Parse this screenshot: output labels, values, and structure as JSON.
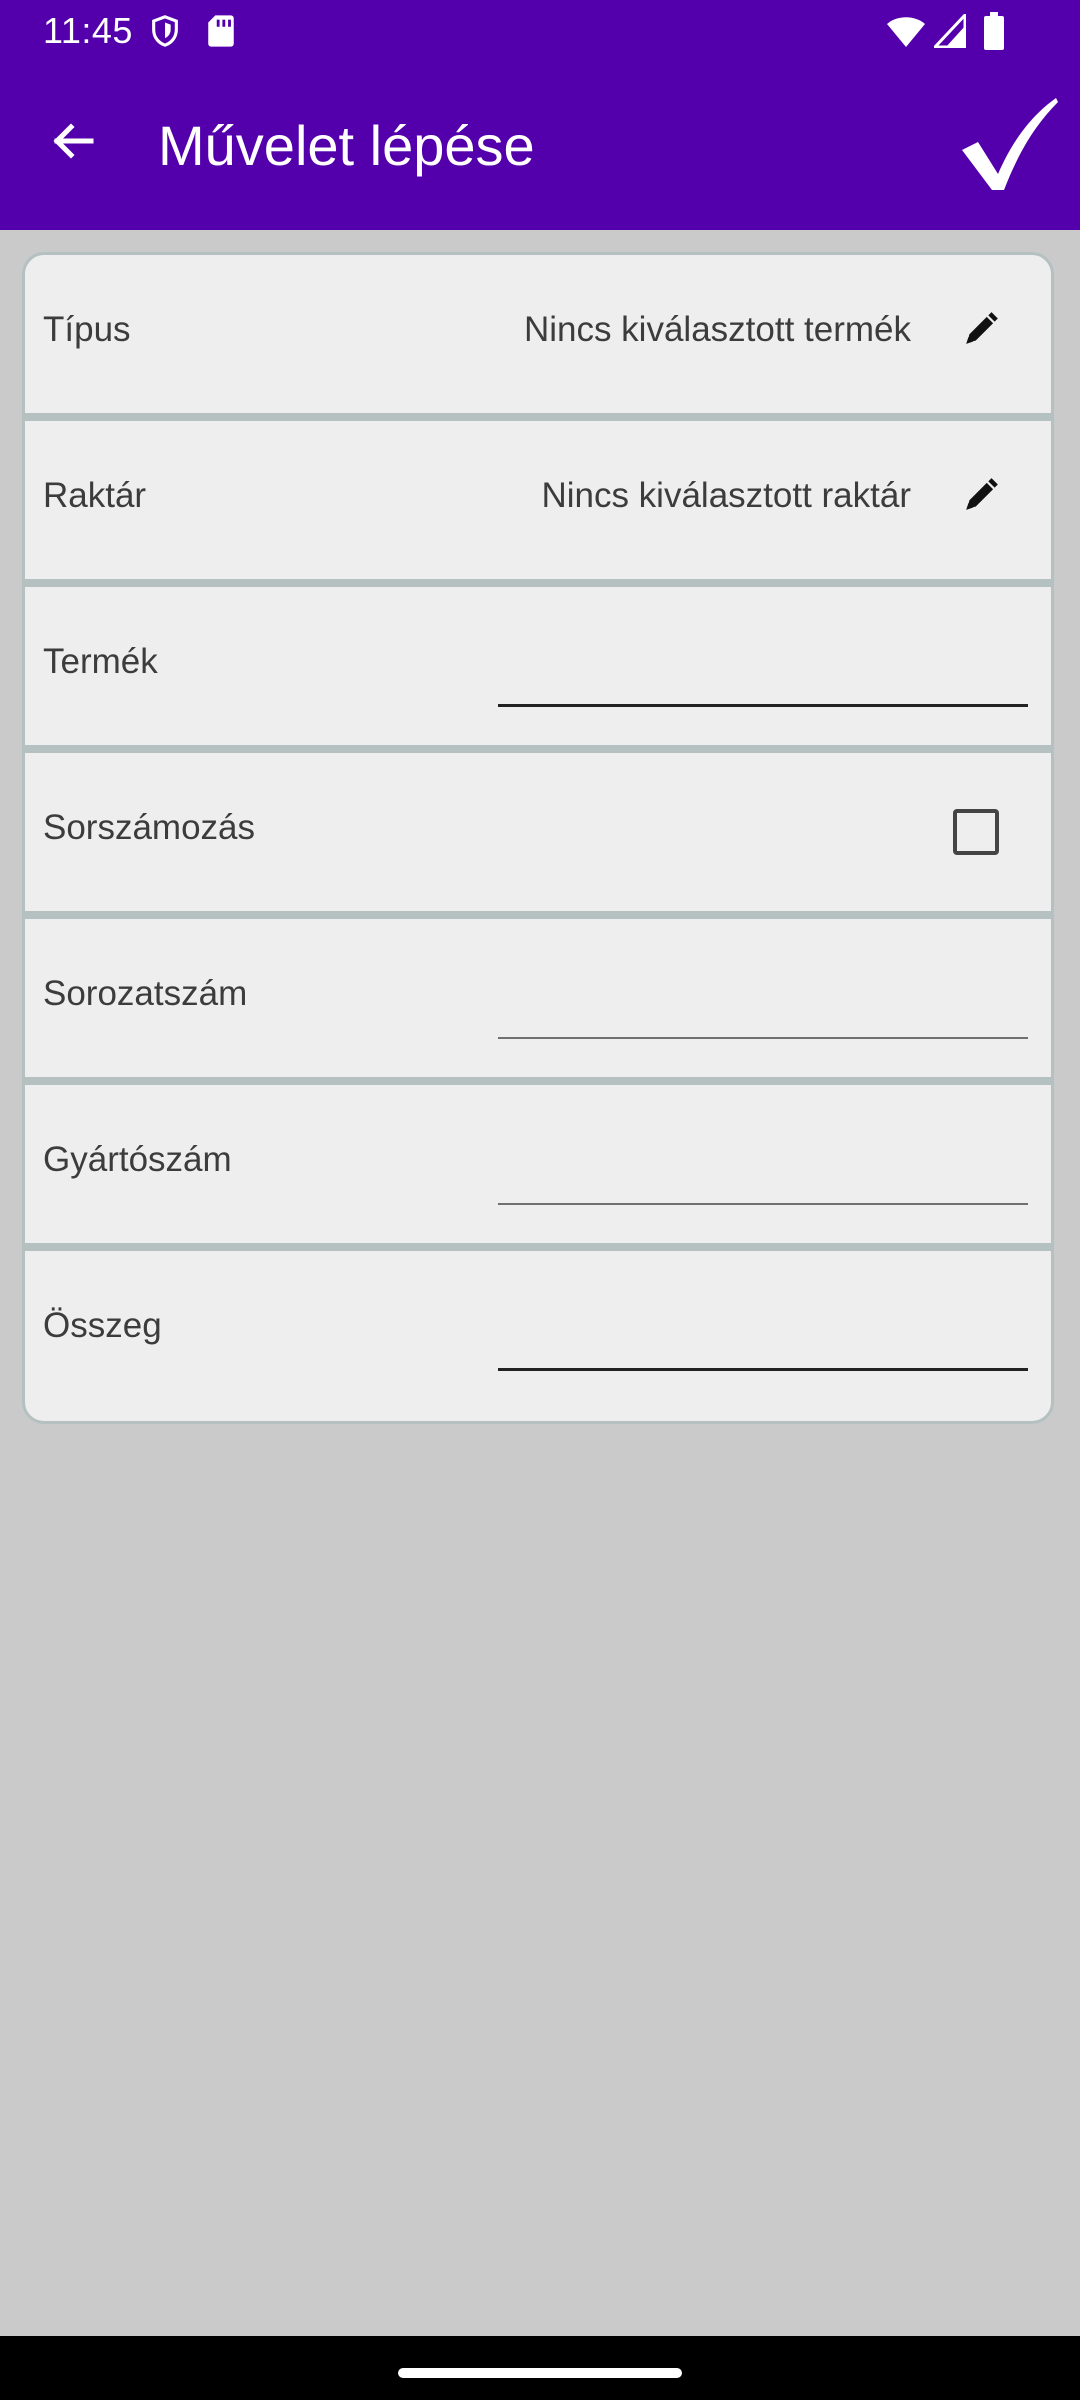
{
  "status_bar": {
    "time": "11:45",
    "icons": [
      "shield-icon",
      "sd-card-icon",
      "wifi-icon",
      "signal-icon",
      "battery-icon"
    ]
  },
  "app_bar": {
    "title": "Művelet lépése",
    "back_icon": "arrow-left-icon",
    "confirm_icon": "checkmark-icon"
  },
  "form": {
    "type_row": {
      "label": "Típus",
      "value": "Nincs kiválasztott termék",
      "icon": "pencil-icon"
    },
    "warehouse_row": {
      "label": "Raktár",
      "value": "Nincs kiválasztott raktár",
      "icon": "pencil-icon"
    },
    "product_row": {
      "label": "Termék",
      "value": ""
    },
    "numbering_row": {
      "label": "Sorszámozás",
      "checked": false
    },
    "batch_row": {
      "label": "Sorozatszám",
      "value": ""
    },
    "serial_row": {
      "label": "Gyártószám",
      "value": ""
    },
    "amount_row": {
      "label": "Összeg",
      "value": ""
    }
  },
  "colors": {
    "primary": "#5300ac",
    "background": "#cacaca",
    "card": "#eeeeee",
    "divider": "#b5c0c0"
  }
}
